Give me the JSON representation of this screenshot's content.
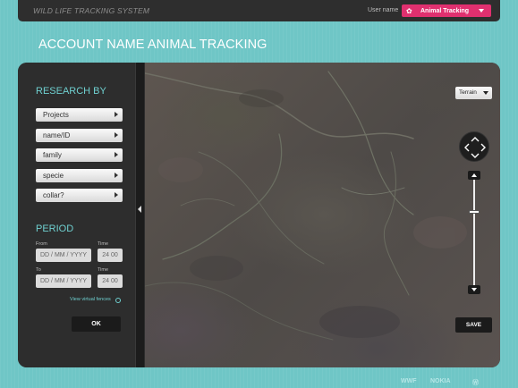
{
  "header": {
    "app_title": "WILD LIFE TRACKING SYSTEM",
    "user_label": "User name",
    "user_select_value": "Animal Tracking"
  },
  "page_title": "ACCOUNT NAME ANIMAL TRACKING",
  "sidebar": {
    "research_title": "RESEARCH BY",
    "filters": [
      {
        "label": "Projects"
      },
      {
        "label": "name/ID"
      },
      {
        "label": "family"
      },
      {
        "label": "specie"
      },
      {
        "label": "collar?"
      }
    ],
    "period_title": "PERIOD",
    "from_label": "From",
    "to_label": "To",
    "time_label": "Time",
    "date_placeholder_from": "DD / MM / YYYY",
    "date_placeholder_to": "DD / MM / YYYY",
    "time_from": "24 00",
    "time_to": "24 00",
    "fence_link": "View virtual fences",
    "ok_label": "OK"
  },
  "map": {
    "terrain_select": "Terrain",
    "save_label": "SAVE"
  },
  "footer": {
    "logos": [
      "WWF",
      "NOKIA",
      "Ⓦ"
    ]
  },
  "colors": {
    "background": "#6fc6c6",
    "accent": "#e0306f",
    "section_title": "#6fd0d0",
    "panel": "#2d2d2d"
  }
}
